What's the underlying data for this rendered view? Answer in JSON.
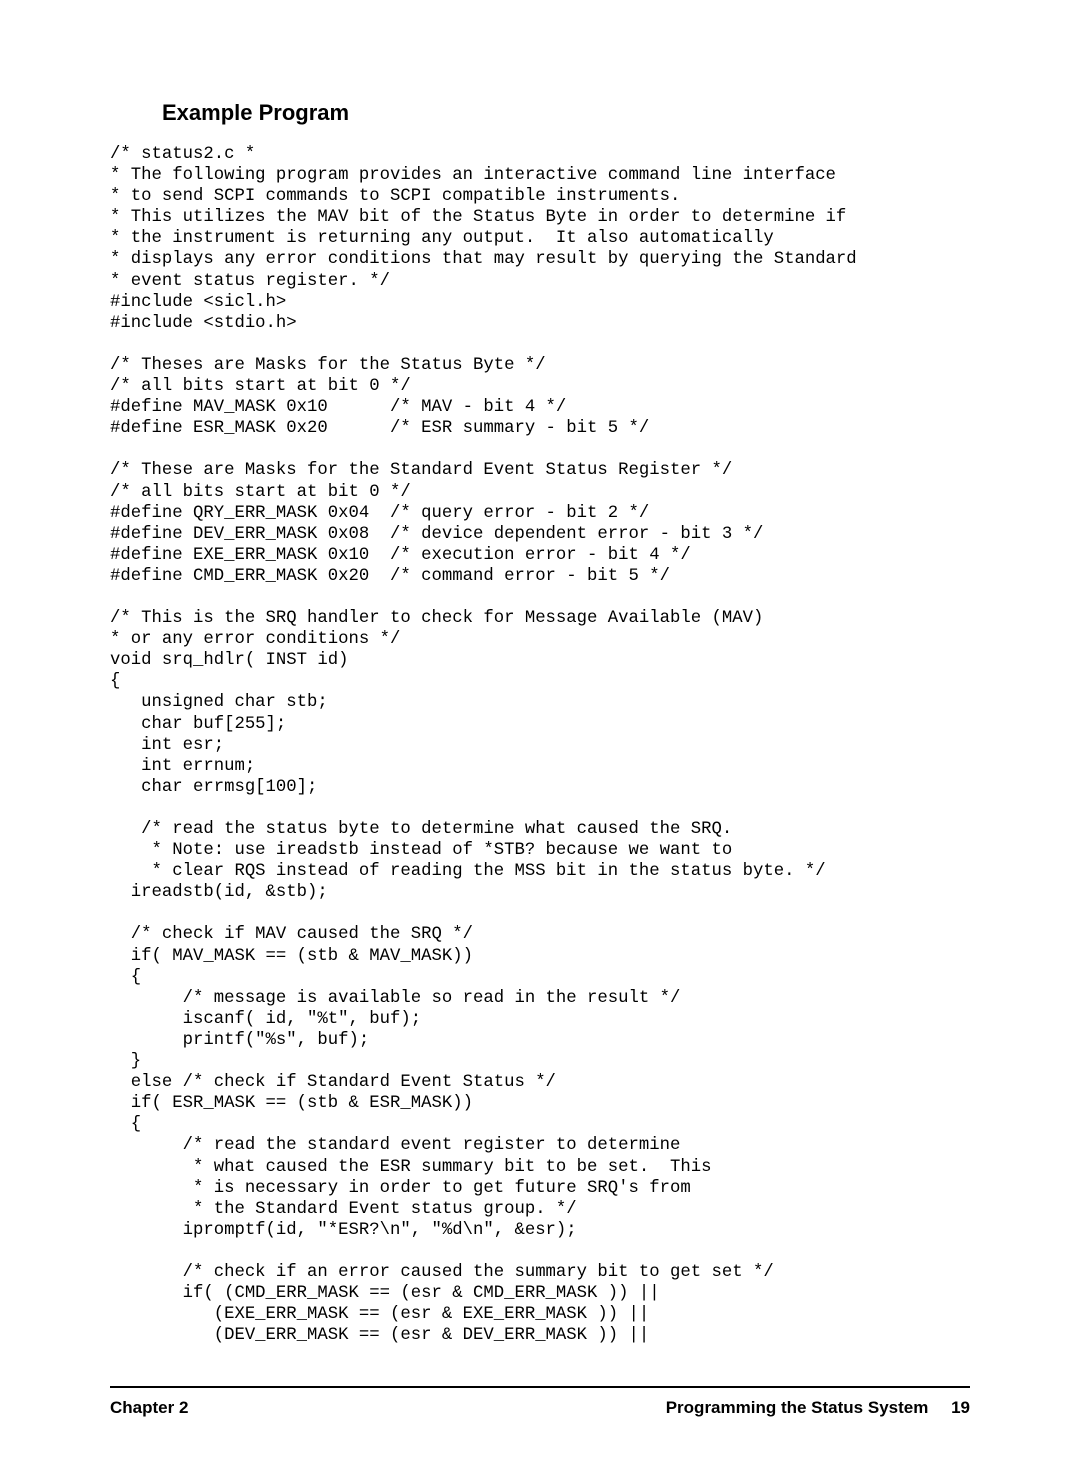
{
  "heading": "Example Program",
  "code": "/* status2.c *\n* The following program provides an interactive command line interface\n* to send SCPI commands to SCPI compatible instruments.\n* This utilizes the MAV bit of the Status Byte in order to determine if\n* the instrument is returning any output.  It also automatically\n* displays any error conditions that may result by querying the Standard\n* event status register. */\n#include <sicl.h>\n#include <stdio.h>\n\n/* Theses are Masks for the Status Byte */\n/* all bits start at bit 0 */\n#define MAV_MASK 0x10      /* MAV - bit 4 */\n#define ESR_MASK 0x20      /* ESR summary - bit 5 */\n\n/* These are Masks for the Standard Event Status Register */\n/* all bits start at bit 0 */\n#define QRY_ERR_MASK 0x04  /* query error - bit 2 */\n#define DEV_ERR_MASK 0x08  /* device dependent error - bit 3 */\n#define EXE_ERR_MASK 0x10  /* execution error - bit 4 */\n#define CMD_ERR_MASK 0x20  /* command error - bit 5 */\n\n/* This is the SRQ handler to check for Message Available (MAV)\n* or any error conditions */\nvoid srq_hdlr( INST id)\n{\n   unsigned char stb;\n   char buf[255];\n   int esr;\n   int errnum;\n   char errmsg[100];\n\n   /* read the status byte to determine what caused the SRQ.\n    * Note: use ireadstb instead of *STB? because we want to\n    * clear RQS instead of reading the MSS bit in the status byte. */\n  ireadstb(id, &stb);\n\n  /* check if MAV caused the SRQ */\n  if( MAV_MASK == (stb & MAV_MASK))\n  {\n       /* message is available so read in the result */\n       iscanf( id, \"%t\", buf);\n       printf(\"%s\", buf);\n  }\n  else /* check if Standard Event Status */\n  if( ESR_MASK == (stb & ESR_MASK))\n  {\n       /* read the standard event register to determine\n        * what caused the ESR summary bit to be set.  This\n        * is necessary in order to get future SRQ's from\n        * the Standard Event status group. */\n       ipromptf(id, \"*ESR?\\n\", \"%d\\n\", &esr);\n\n       /* check if an error caused the summary bit to get set */\n       if( (CMD_ERR_MASK == (esr & CMD_ERR_MASK )) ||\n          (EXE_ERR_MASK == (esr & EXE_ERR_MASK )) ||\n          (DEV_ERR_MASK == (esr & DEV_ERR_MASK )) ||",
  "footer": {
    "left": "Chapter 2",
    "right_title": "Programming the Status System",
    "page_number": "19"
  }
}
